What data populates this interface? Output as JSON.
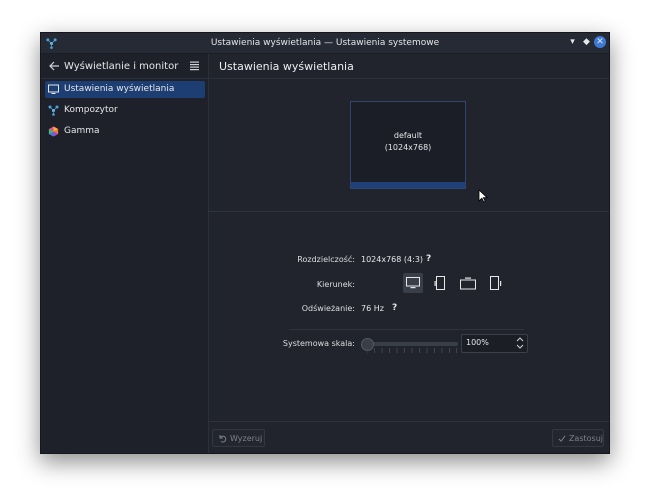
{
  "window": {
    "title": "Ustawienia wyświetlania — Ustawienia systemowe",
    "minimize_label": "▾",
    "maximize_label": "◆",
    "close_label": "✕"
  },
  "sidebar": {
    "title": "Wyświetlanie i monitor",
    "items": [
      {
        "label": "Ustawienia wyświetlania",
        "icon": "monitor-icon",
        "active": true
      },
      {
        "label": "Kompozytor",
        "icon": "compositor-icon",
        "active": false
      },
      {
        "label": "Gamma",
        "icon": "gamma-icon",
        "active": false
      }
    ]
  },
  "main": {
    "title": "Ustawienia wyświetlania",
    "monitor": {
      "name": "default",
      "resolution": "(1024x768)"
    },
    "resolution_label": "Rozdzielczość:",
    "resolution_value": "1024x768 (4:3)",
    "orientation_label": "Kierunek:",
    "refresh_label": "Odświeżanie:",
    "refresh_value": "76 Hz",
    "help_symbol": "?",
    "scale_label": "Systemowa skala:",
    "scale_value": "100%",
    "scale_fraction": 0.0
  },
  "footer": {
    "reset_label": "Wyzeruj",
    "apply_label": "Zastosuj"
  },
  "colors": {
    "accent": "#3c7ad6",
    "active_item": "#1d3e73",
    "background": "#21242c"
  }
}
